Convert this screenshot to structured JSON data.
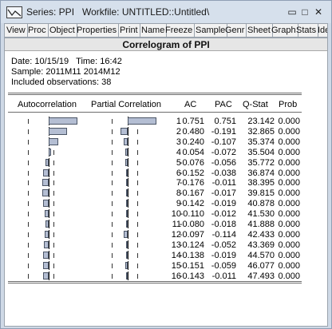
{
  "window": {
    "title": "Series: PPI   Workfile: UNTITLED::Untitled\\",
    "controls": {
      "minimize": "▭",
      "maximize": "□",
      "close": "✕"
    }
  },
  "toolbar": [
    "View",
    "Proc",
    "Object",
    "Properties",
    "Print",
    "Name",
    "Freeze",
    "Sample",
    "Genr",
    "Sheet",
    "Graph",
    "Stats",
    "Iden"
  ],
  "view": {
    "title": "Correlogram of PPI",
    "date_line": "Date: 10/15/19   Time: 16:42",
    "sample_line": "Sample: 2011M11 2014M12",
    "obs_line": "Included observations: 38",
    "columns": [
      "Autocorrelation",
      "Partial Correlation",
      "AC",
      "PAC",
      "Q-Stat",
      "Prob"
    ],
    "rows": [
      {
        "lag": "1",
        "ac": "0.751",
        "pac": "0.751",
        "q": "23.142",
        "prob": "0.000"
      },
      {
        "lag": "2",
        "ac": "0.480",
        "pac": "-0.191",
        "q": "32.865",
        "prob": "0.000"
      },
      {
        "lag": "3",
        "ac": "0.240",
        "pac": "-0.107",
        "q": "35.374",
        "prob": "0.000"
      },
      {
        "lag": "4",
        "ac": "0.054",
        "pac": "-0.072",
        "q": "35.504",
        "prob": "0.000"
      },
      {
        "lag": "5",
        "ac": "-0.076",
        "pac": "-0.056",
        "q": "35.772",
        "prob": "0.000"
      },
      {
        "lag": "6",
        "ac": "-0.152",
        "pac": "-0.038",
        "q": "36.874",
        "prob": "0.000"
      },
      {
        "lag": "7",
        "ac": "-0.176",
        "pac": "-0.011",
        "q": "38.395",
        "prob": "0.000"
      },
      {
        "lag": "8",
        "ac": "-0.167",
        "pac": "-0.017",
        "q": "39.815",
        "prob": "0.000"
      },
      {
        "lag": "9",
        "ac": "-0.142",
        "pac": "-0.019",
        "q": "40.878",
        "prob": "0.000"
      },
      {
        "lag": "10",
        "ac": "-0.110",
        "pac": "-0.012",
        "q": "41.530",
        "prob": "0.000"
      },
      {
        "lag": "11",
        "ac": "-0.080",
        "pac": "-0.018",
        "q": "41.888",
        "prob": "0.000"
      },
      {
        "lag": "12",
        "ac": "-0.097",
        "pac": "-0.114",
        "q": "42.433",
        "prob": "0.000"
      },
      {
        "lag": "13",
        "ac": "-0.124",
        "pac": "-0.052",
        "q": "43.369",
        "prob": "0.000"
      },
      {
        "lag": "14",
        "ac": "-0.138",
        "pac": "-0.019",
        "q": "44.570",
        "prob": "0.000"
      },
      {
        "lag": "15",
        "ac": "-0.151",
        "pac": "-0.059",
        "q": "46.077",
        "prob": "0.000"
      },
      {
        "lag": "16",
        "ac": "-0.143",
        "pac": "-0.011",
        "q": "47.493",
        "prob": "0.000"
      }
    ]
  }
}
